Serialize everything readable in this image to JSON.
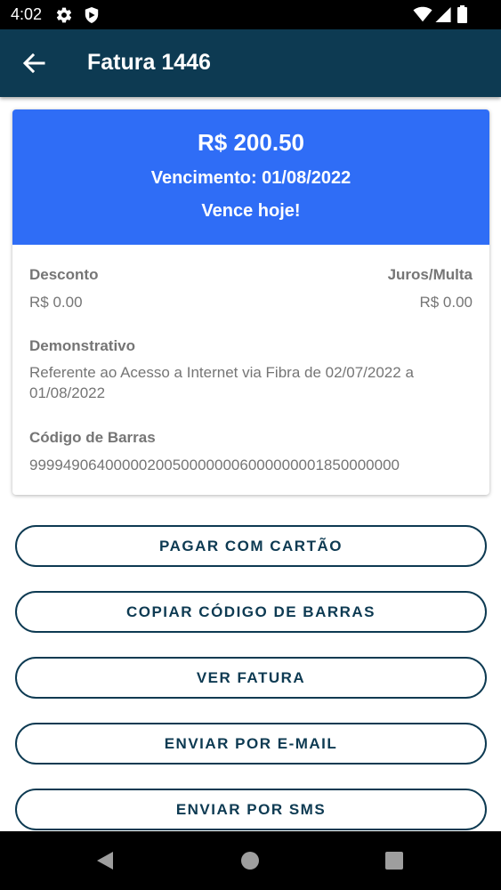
{
  "status_bar": {
    "time": "4:02"
  },
  "app_bar": {
    "title": "Fatura 1446"
  },
  "invoice": {
    "amount": "R$ 200.50",
    "due_date": "Vencimento: 01/08/2022",
    "due_status": "Vence hoje!",
    "discount_label": "Desconto",
    "discount_value": "R$ 0.00",
    "interest_label": "Juros/Multa",
    "interest_value": "R$ 0.00",
    "statement_label": "Demonstrativo",
    "statement_value": "Referente ao Acesso a Internet via Fibra de 02/07/2022 a 01/08/2022",
    "barcode_label": "Código de Barras",
    "barcode_value": "99994906400000200500000006000000001850000000"
  },
  "actions": {
    "pay_card": "PAGAR COM CARTÃO",
    "copy_barcode": "COPIAR CÓDIGO DE BARRAS",
    "view_invoice": "VER FATURA",
    "send_email": "ENVIAR POR E-MAIL",
    "send_sms": "ENVIAR POR SMS"
  },
  "colors": {
    "app_bar": "#0d3a52",
    "header": "#2f6df6",
    "text_muted": "#757575"
  },
  "icons": {
    "back": "arrow-left-icon",
    "status": [
      "gear-icon",
      "shield-icon",
      "wifi-icon",
      "signal-icon",
      "battery-icon"
    ],
    "nav": [
      "nav-back-icon",
      "nav-home-icon",
      "nav-recents-icon"
    ]
  }
}
